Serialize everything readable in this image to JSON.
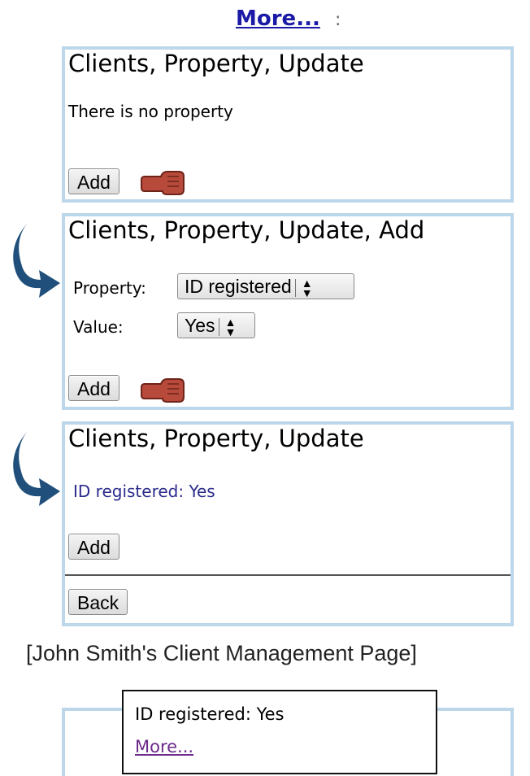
{
  "top_link": {
    "label": "More...",
    "suffix": ":"
  },
  "panel1": {
    "title": "Clients, Property, Update",
    "message": "There is no property",
    "add_label": "Add"
  },
  "panel2": {
    "title": "Clients, Property, Update, Add",
    "property_label": "Property:",
    "property_value": "ID registered",
    "value_label": "Value:",
    "value_value": "Yes",
    "add_label": "Add"
  },
  "panel3": {
    "title": "Clients, Property, Update",
    "property_line": "ID registered: Yes",
    "add_label": "Add",
    "back_label": "Back"
  },
  "caption": "[John Smith's Client Management Page]",
  "summary_box": {
    "property_line": "ID registered: Yes",
    "more_link": "More..."
  },
  "colors": {
    "panel_border": "#bcd6ea",
    "link": "#1a1aa6",
    "property_text": "#2b2b8c",
    "visited_link": "#6b2a8a",
    "arrow": "#1f4f7a",
    "hand": "#b84a3c"
  },
  "icons": {
    "hand": "pointing-hand-icon",
    "arrow": "curved-arrow-icon",
    "select_arrows": "updown-arrows-icon"
  }
}
